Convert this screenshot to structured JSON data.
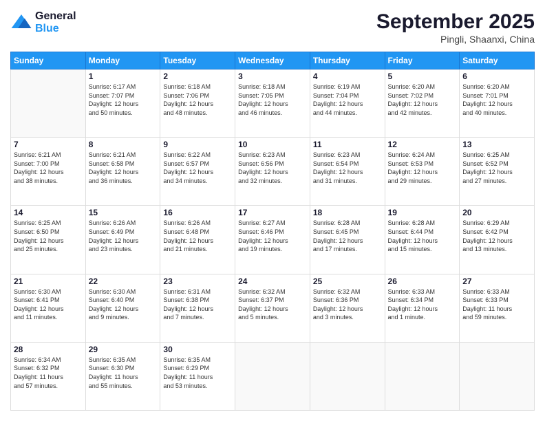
{
  "logo": {
    "line1": "General",
    "line2": "Blue"
  },
  "title": "September 2025",
  "location": "Pingli, Shaanxi, China",
  "days_of_week": [
    "Sunday",
    "Monday",
    "Tuesday",
    "Wednesday",
    "Thursday",
    "Friday",
    "Saturday"
  ],
  "weeks": [
    [
      {
        "day": "",
        "content": ""
      },
      {
        "day": "1",
        "content": "Sunrise: 6:17 AM\nSunset: 7:07 PM\nDaylight: 12 hours\nand 50 minutes."
      },
      {
        "day": "2",
        "content": "Sunrise: 6:18 AM\nSunset: 7:06 PM\nDaylight: 12 hours\nand 48 minutes."
      },
      {
        "day": "3",
        "content": "Sunrise: 6:18 AM\nSunset: 7:05 PM\nDaylight: 12 hours\nand 46 minutes."
      },
      {
        "day": "4",
        "content": "Sunrise: 6:19 AM\nSunset: 7:04 PM\nDaylight: 12 hours\nand 44 minutes."
      },
      {
        "day": "5",
        "content": "Sunrise: 6:20 AM\nSunset: 7:02 PM\nDaylight: 12 hours\nand 42 minutes."
      },
      {
        "day": "6",
        "content": "Sunrise: 6:20 AM\nSunset: 7:01 PM\nDaylight: 12 hours\nand 40 minutes."
      }
    ],
    [
      {
        "day": "7",
        "content": "Sunrise: 6:21 AM\nSunset: 7:00 PM\nDaylight: 12 hours\nand 38 minutes."
      },
      {
        "day": "8",
        "content": "Sunrise: 6:21 AM\nSunset: 6:58 PM\nDaylight: 12 hours\nand 36 minutes."
      },
      {
        "day": "9",
        "content": "Sunrise: 6:22 AM\nSunset: 6:57 PM\nDaylight: 12 hours\nand 34 minutes."
      },
      {
        "day": "10",
        "content": "Sunrise: 6:23 AM\nSunset: 6:56 PM\nDaylight: 12 hours\nand 32 minutes."
      },
      {
        "day": "11",
        "content": "Sunrise: 6:23 AM\nSunset: 6:54 PM\nDaylight: 12 hours\nand 31 minutes."
      },
      {
        "day": "12",
        "content": "Sunrise: 6:24 AM\nSunset: 6:53 PM\nDaylight: 12 hours\nand 29 minutes."
      },
      {
        "day": "13",
        "content": "Sunrise: 6:25 AM\nSunset: 6:52 PM\nDaylight: 12 hours\nand 27 minutes."
      }
    ],
    [
      {
        "day": "14",
        "content": "Sunrise: 6:25 AM\nSunset: 6:50 PM\nDaylight: 12 hours\nand 25 minutes."
      },
      {
        "day": "15",
        "content": "Sunrise: 6:26 AM\nSunset: 6:49 PM\nDaylight: 12 hours\nand 23 minutes."
      },
      {
        "day": "16",
        "content": "Sunrise: 6:26 AM\nSunset: 6:48 PM\nDaylight: 12 hours\nand 21 minutes."
      },
      {
        "day": "17",
        "content": "Sunrise: 6:27 AM\nSunset: 6:46 PM\nDaylight: 12 hours\nand 19 minutes."
      },
      {
        "day": "18",
        "content": "Sunrise: 6:28 AM\nSunset: 6:45 PM\nDaylight: 12 hours\nand 17 minutes."
      },
      {
        "day": "19",
        "content": "Sunrise: 6:28 AM\nSunset: 6:44 PM\nDaylight: 12 hours\nand 15 minutes."
      },
      {
        "day": "20",
        "content": "Sunrise: 6:29 AM\nSunset: 6:42 PM\nDaylight: 12 hours\nand 13 minutes."
      }
    ],
    [
      {
        "day": "21",
        "content": "Sunrise: 6:30 AM\nSunset: 6:41 PM\nDaylight: 12 hours\nand 11 minutes."
      },
      {
        "day": "22",
        "content": "Sunrise: 6:30 AM\nSunset: 6:40 PM\nDaylight: 12 hours\nand 9 minutes."
      },
      {
        "day": "23",
        "content": "Sunrise: 6:31 AM\nSunset: 6:38 PM\nDaylight: 12 hours\nand 7 minutes."
      },
      {
        "day": "24",
        "content": "Sunrise: 6:32 AM\nSunset: 6:37 PM\nDaylight: 12 hours\nand 5 minutes."
      },
      {
        "day": "25",
        "content": "Sunrise: 6:32 AM\nSunset: 6:36 PM\nDaylight: 12 hours\nand 3 minutes."
      },
      {
        "day": "26",
        "content": "Sunrise: 6:33 AM\nSunset: 6:34 PM\nDaylight: 12 hours\nand 1 minute."
      },
      {
        "day": "27",
        "content": "Sunrise: 6:33 AM\nSunset: 6:33 PM\nDaylight: 11 hours\nand 59 minutes."
      }
    ],
    [
      {
        "day": "28",
        "content": "Sunrise: 6:34 AM\nSunset: 6:32 PM\nDaylight: 11 hours\nand 57 minutes."
      },
      {
        "day": "29",
        "content": "Sunrise: 6:35 AM\nSunset: 6:30 PM\nDaylight: 11 hours\nand 55 minutes."
      },
      {
        "day": "30",
        "content": "Sunrise: 6:35 AM\nSunset: 6:29 PM\nDaylight: 11 hours\nand 53 minutes."
      },
      {
        "day": "",
        "content": ""
      },
      {
        "day": "",
        "content": ""
      },
      {
        "day": "",
        "content": ""
      },
      {
        "day": "",
        "content": ""
      }
    ]
  ]
}
